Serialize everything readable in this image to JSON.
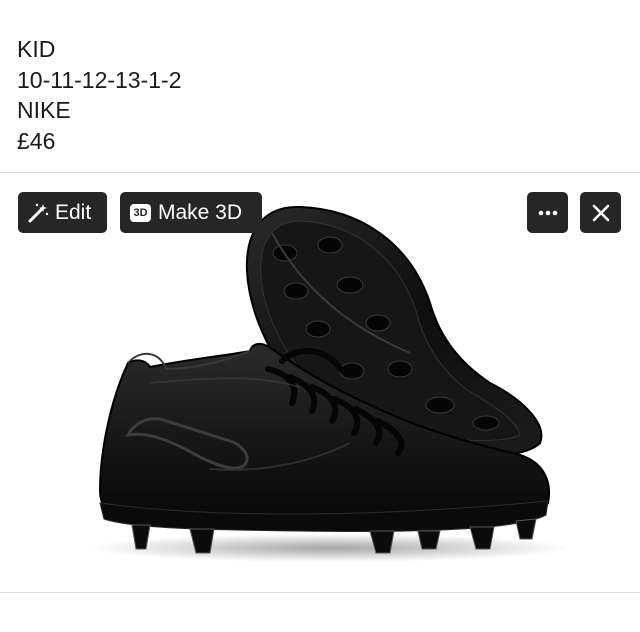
{
  "listing": {
    "lines": [
      "KID",
      "10-11-12-13-1-2",
      "NIKE",
      "£46"
    ]
  },
  "toolbar": {
    "edit_label": "Edit",
    "edit_icon": "magic-wand-icon",
    "make3d_badge": "3D",
    "make3d_label": "Make 3D",
    "more_icon": "ellipsis-icon",
    "close_icon": "close-icon"
  },
  "colors": {
    "button_bg": "#262626",
    "button_text": "#ffffff",
    "text": "#1a1a1a"
  }
}
